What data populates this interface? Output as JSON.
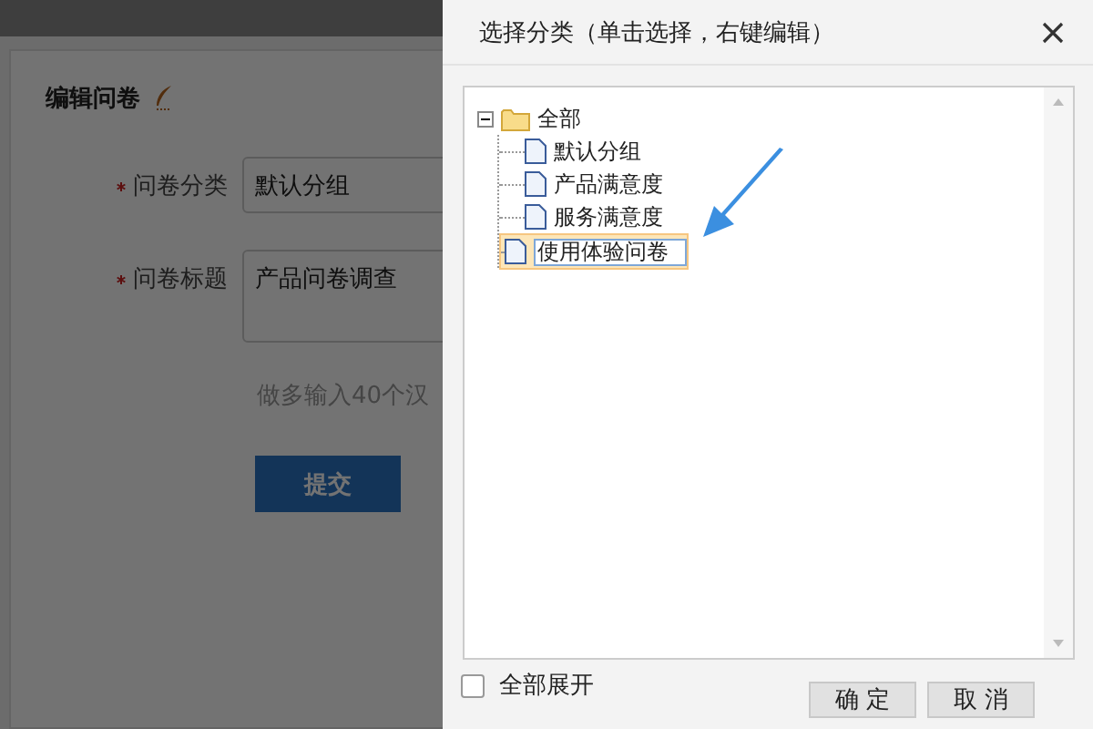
{
  "page": {
    "heading": "编辑问卷",
    "fields": [
      {
        "label": "问卷分类",
        "required": true,
        "kind": "select",
        "value": "默认分组"
      },
      {
        "label": "问卷标题",
        "required": true,
        "kind": "textarea",
        "value": "产品问卷调查"
      }
    ],
    "hint": "做多输入40个汉",
    "submit": "提交"
  },
  "dialog": {
    "title": "选择分类（单击选择，右键编辑）",
    "tree": {
      "label": "全部",
      "expanded": true,
      "children": [
        {
          "label": "默认分组",
          "editing": false
        },
        {
          "label": "产品满意度",
          "editing": false
        },
        {
          "label": "服务满意度",
          "editing": false
        },
        {
          "label": "使用体验问卷",
          "editing": true
        }
      ]
    },
    "expand_all": {
      "label": "全部展开",
      "checked": false
    },
    "buttons": [
      "确 定",
      "取 消"
    ]
  }
}
